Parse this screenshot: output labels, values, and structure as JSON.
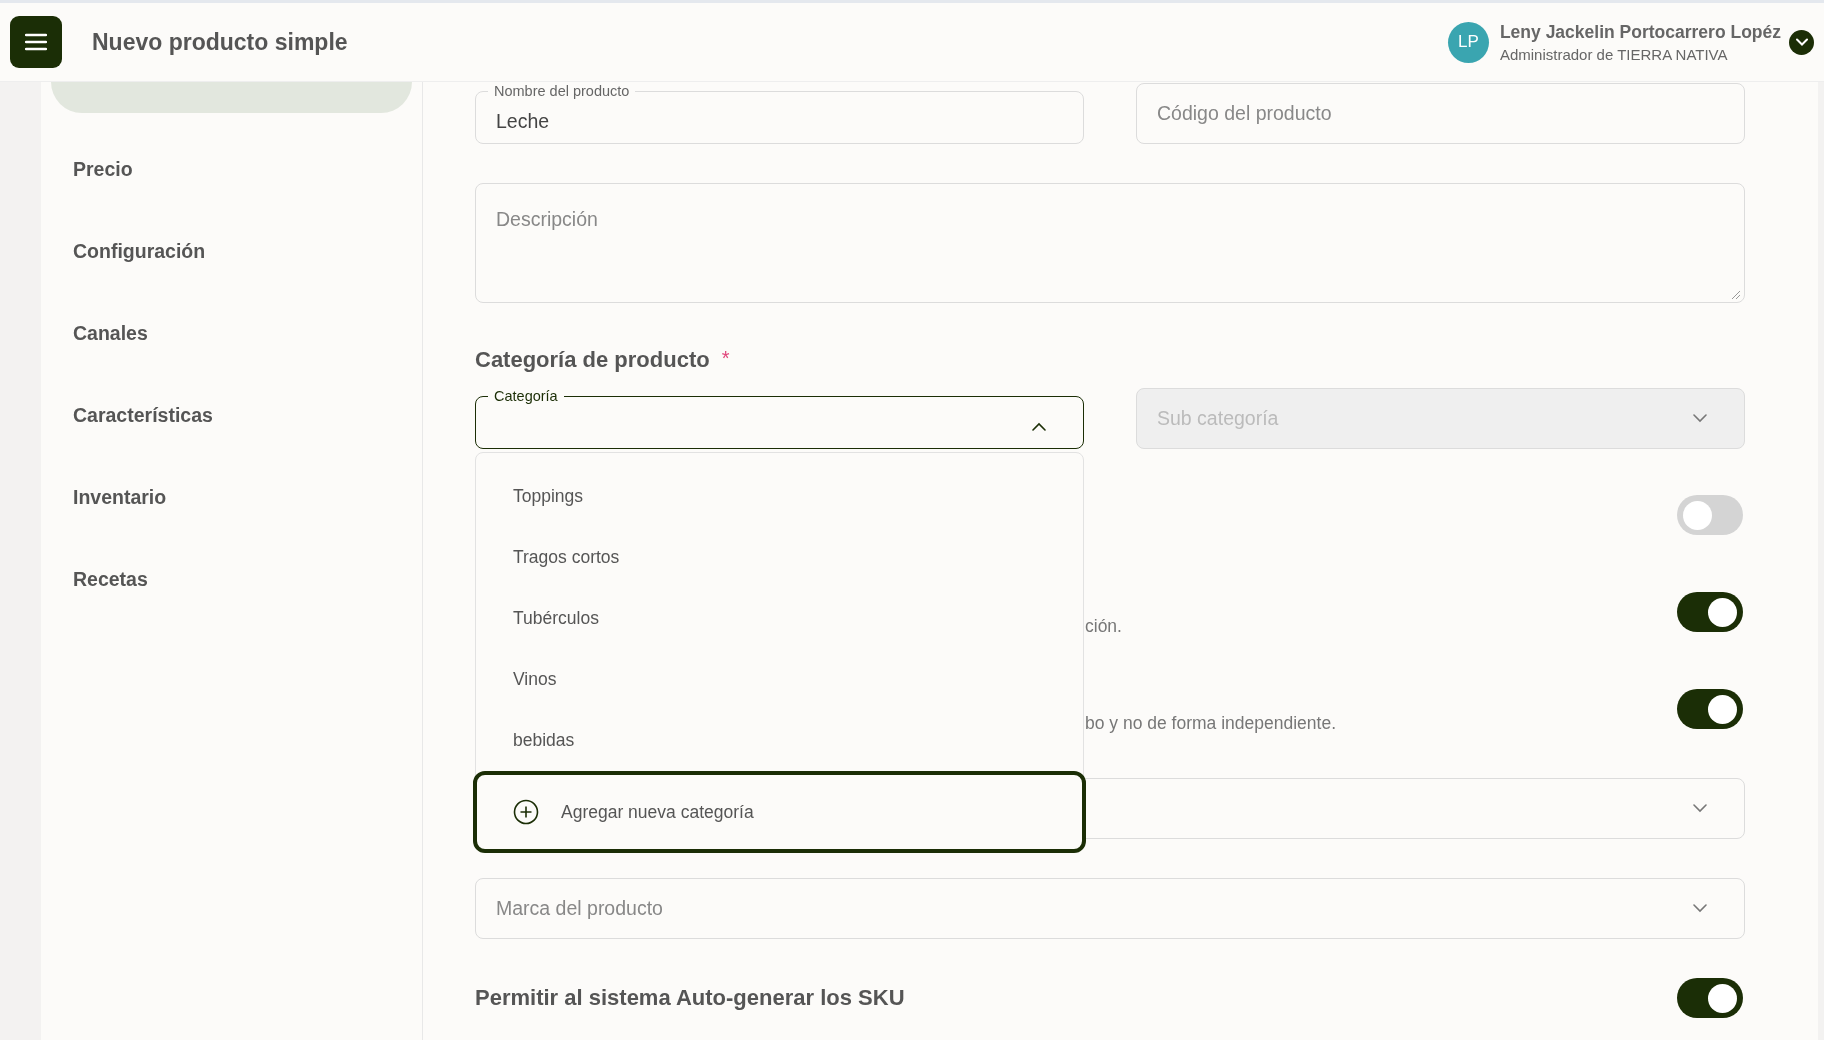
{
  "header": {
    "title": "Nuevo producto simple",
    "user": {
      "initials": "LP",
      "name": "Leny Jackelin Portocarrero Lopéz",
      "role": "Administrador de TIERRA NATIVA"
    }
  },
  "sidebar": {
    "items": [
      {
        "selected": true
      },
      {
        "label": "Precio",
        "selected": false
      },
      {
        "label": "Configuración",
        "selected": false
      },
      {
        "label": "Canales",
        "selected": false
      },
      {
        "label": "Características",
        "selected": false
      },
      {
        "label": "Inventario",
        "selected": false
      },
      {
        "label": "Recetas",
        "selected": false
      }
    ]
  },
  "form": {
    "name_field": {
      "label": "Nombre del producto",
      "value": "Leche"
    },
    "code_field": {
      "placeholder": "Código del producto"
    },
    "description_field": {
      "placeholder": "Descripción"
    },
    "category_section": {
      "title": "Categoría de producto",
      "required_mark": "*"
    },
    "category_select": {
      "label": "Categoría",
      "expanded": true,
      "options": [
        "Toppings",
        "Tragos cortos",
        "Tubérculos",
        "Vinos",
        "bebidas"
      ],
      "add_option": "Agregar nueva categoría"
    },
    "subcategory_select": {
      "placeholder": "Sub categoría",
      "disabled": true
    },
    "toggles": [
      {
        "on": false
      },
      {
        "description": "ción.",
        "on": true
      },
      {
        "description": "bo y no de forma independiente.",
        "on": true
      }
    ],
    "brand_select": {
      "placeholder": "Marca del producto"
    },
    "sku_toggle": {
      "title": "Permitir al sistema Auto-generar los SKU",
      "on": true
    }
  }
}
